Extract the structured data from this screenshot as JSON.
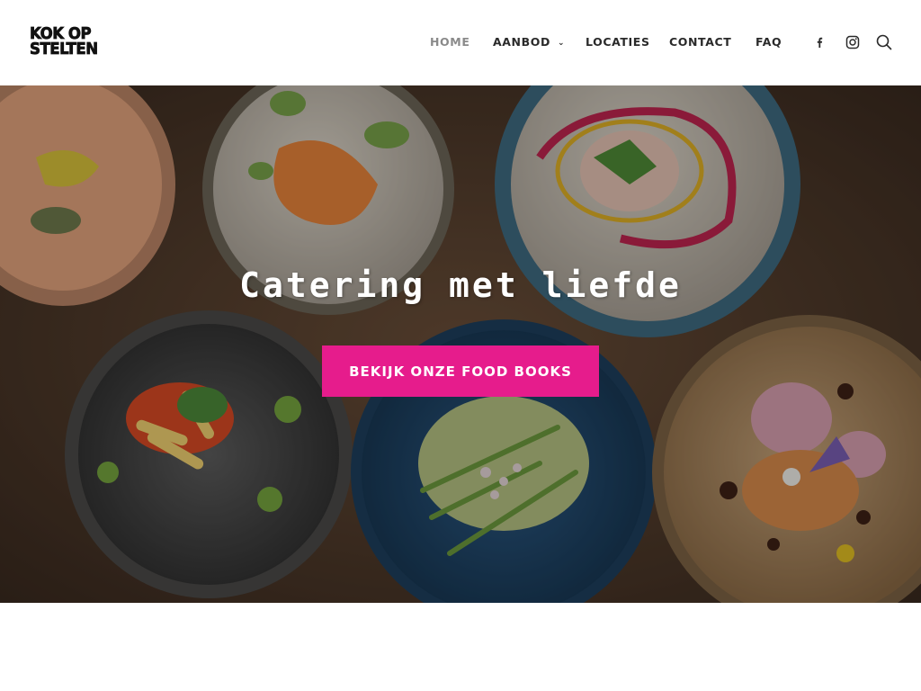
{
  "brand": {
    "logo_line1": "KOK OP",
    "logo_line2": "STELTEN"
  },
  "nav": {
    "items": [
      {
        "label": "HOME",
        "active": true
      },
      {
        "label": "AANBOD",
        "has_dropdown": true
      },
      {
        "label": "LOCATIES"
      },
      {
        "label": "CONTACT"
      },
      {
        "label": "FAQ"
      }
    ],
    "icons": [
      "facebook-icon",
      "instagram-icon",
      "search-icon"
    ]
  },
  "hero": {
    "title": "Catering met liefde",
    "cta_label": "BEKIJK ONZE FOOD BOOKS"
  },
  "colors": {
    "accent": "#e61c8c",
    "nav_text": "#2a2a2a",
    "nav_active": "#8a8a8a"
  }
}
